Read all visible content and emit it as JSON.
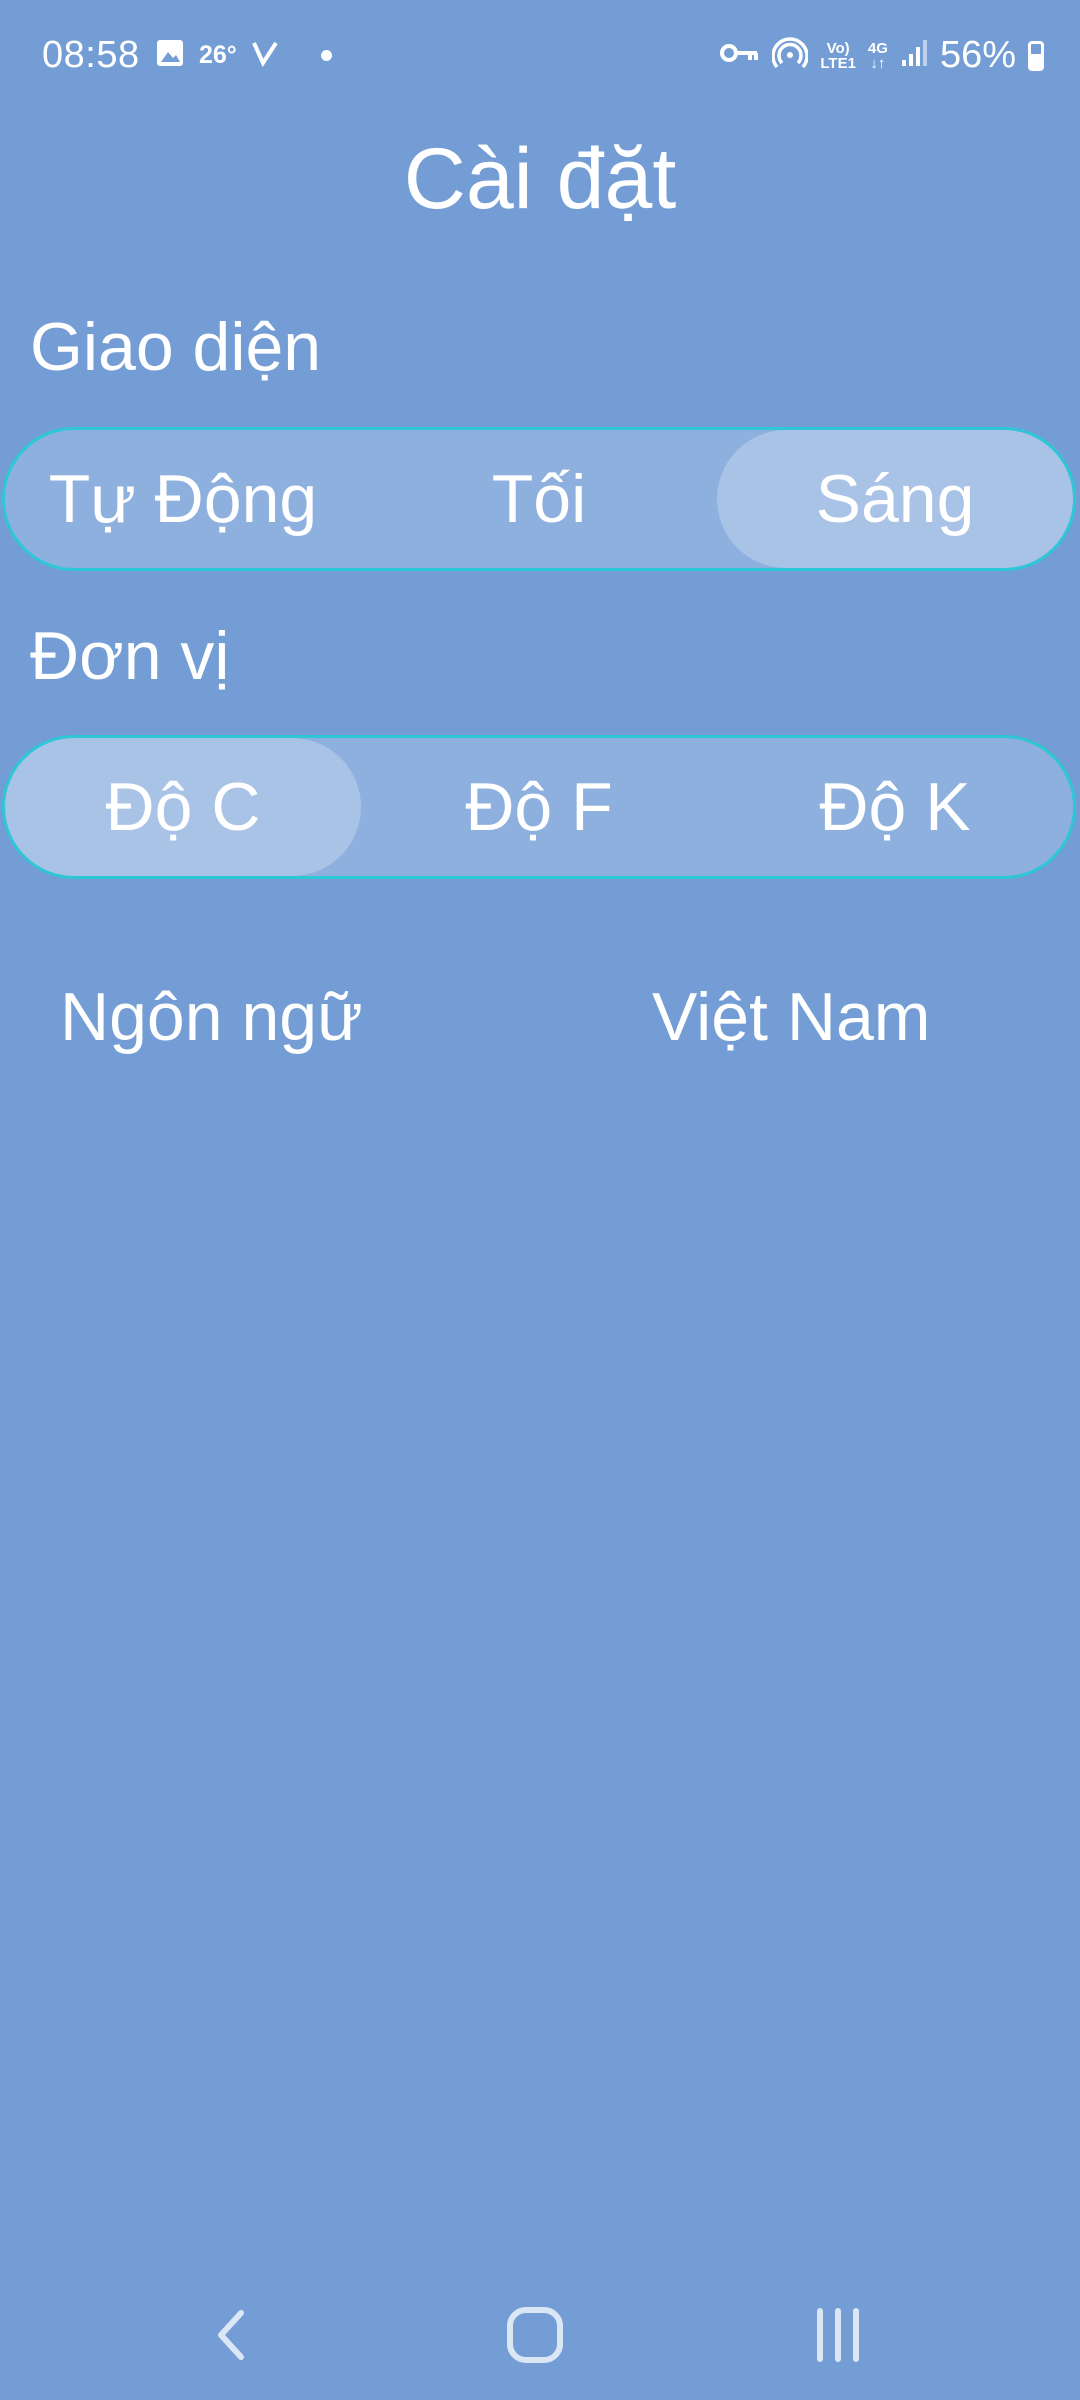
{
  "status_bar": {
    "time": "08:58",
    "temperature": "26°",
    "network_volte": "Vo)",
    "network_lte": "LTE1",
    "network_gen": "4G",
    "battery_percent": "56%",
    "icons": [
      "gallery-icon",
      "v-app-icon",
      "notification-dot-icon",
      "vpn-key-icon",
      "hotspot-icon",
      "signal-icon",
      "battery-icon"
    ]
  },
  "page": {
    "title": "Cài đặt"
  },
  "theme_section": {
    "label": "Giao diện",
    "options": [
      "Tự Động",
      "Tối",
      "Sáng"
    ],
    "selected": "Sáng"
  },
  "unit_section": {
    "label": "Đơn vị",
    "options": [
      "Độ C",
      "Độ F",
      "Độ K"
    ],
    "selected": "Độ C"
  },
  "language_row": {
    "label": "Ngôn ngữ",
    "value": "Việt Nam"
  },
  "nav_bar": {
    "icons": [
      "back-icon",
      "home-icon",
      "recents-icon"
    ]
  },
  "colors": {
    "background": "#739dd4",
    "segment_border": "#2dc7d6",
    "segment_fill": "#8eb0df",
    "segment_selected": "#a9c3e7"
  }
}
